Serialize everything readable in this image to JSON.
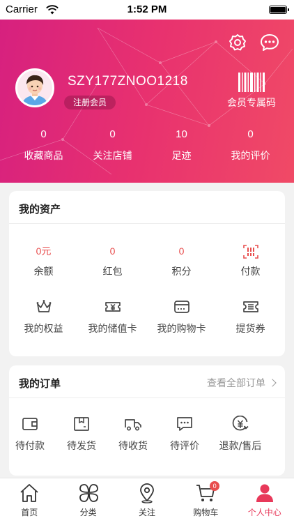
{
  "status_bar": {
    "carrier": "Carrier",
    "time": "1:52 PM"
  },
  "profile": {
    "username": "SZY177ZNOO1218",
    "member_level": "注册会员",
    "member_code_label": "会员专属码"
  },
  "stats": [
    {
      "value": "0",
      "label": "收藏商品"
    },
    {
      "value": "0",
      "label": "关注店铺"
    },
    {
      "value": "10",
      "label": "足迹"
    },
    {
      "value": "0",
      "label": "我的评价"
    }
  ],
  "assets": {
    "title": "我的资产",
    "values": [
      {
        "value": "0元",
        "label": "余额"
      },
      {
        "value": "0",
        "label": "红包"
      },
      {
        "value": "0",
        "label": "积分"
      },
      {
        "icon": "payment-code-icon",
        "label": "付款"
      }
    ],
    "tools": [
      {
        "icon": "crown-icon",
        "label": "我的权益"
      },
      {
        "icon": "stored-value-card-icon",
        "label": "我的储值卡"
      },
      {
        "icon": "shopping-card-icon",
        "label": "我的购物卡"
      },
      {
        "icon": "pickup-voucher-icon",
        "label": "提货券"
      }
    ]
  },
  "orders": {
    "title": "我的订单",
    "view_all": "查看全部订单",
    "items": [
      {
        "icon": "wallet-icon",
        "label": "待付款"
      },
      {
        "icon": "box-icon",
        "label": "待发货"
      },
      {
        "icon": "truck-icon",
        "label": "待收货"
      },
      {
        "icon": "comment-icon",
        "label": "待评价"
      },
      {
        "icon": "refund-icon",
        "label": "退款/售后"
      }
    ]
  },
  "tabbar": {
    "items": [
      {
        "icon": "home-icon",
        "label": "首页"
      },
      {
        "icon": "category-icon",
        "label": "分类"
      },
      {
        "icon": "location-icon",
        "label": "关注"
      },
      {
        "icon": "cart-icon",
        "label": "购物车",
        "badge": "0"
      },
      {
        "icon": "user-icon",
        "label": "个人中心",
        "active": true
      }
    ]
  },
  "colors": {
    "accent": "#e8395a",
    "header_start": "#d6207f",
    "header_end": "#f04a66",
    "value_red": "#e84e4e"
  }
}
